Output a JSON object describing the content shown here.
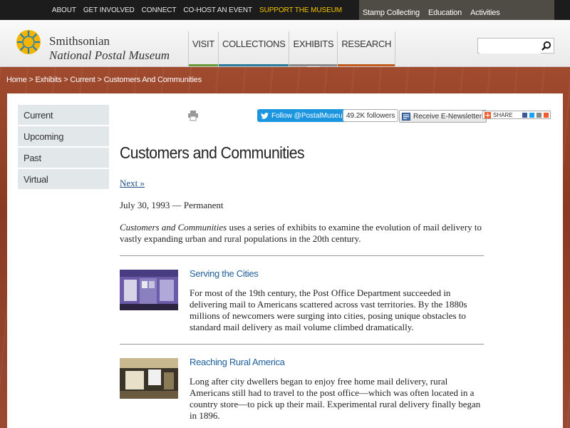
{
  "topbar": {
    "links": [
      "ABOUT",
      "GET INVOLVED",
      "CONNECT",
      "CO-HOST AN EVENT",
      "SUPPORT THE MUSEUM"
    ],
    "dropdown_links": [
      "Stamp Collecting",
      "Education",
      "Activities"
    ],
    "support_color": "#f5c400"
  },
  "header": {
    "logo_line1": "Smithsonian",
    "logo_line2": "National Postal Museum",
    "nav": [
      {
        "label": "VISIT",
        "color": "#6a9a3a"
      },
      {
        "label": "COLLECTIONS",
        "color": "#2d7a9a"
      },
      {
        "label": "EXHIBITS",
        "color": "#8a8a8a",
        "active": true
      },
      {
        "label": "RESEARCH",
        "color": "#c25a1e"
      }
    ],
    "search_placeholder": ""
  },
  "breadcrumb": [
    "Home",
    "Exhibits",
    "Current",
    "Customers And Communities"
  ],
  "sidenav": [
    "Current",
    "Upcoming",
    "Past",
    "Virtual"
  ],
  "social": {
    "twitter_label": "Follow @PostalMuseum",
    "followers": "49.2K followers",
    "newsletter": "Receive E-Newsletter",
    "share": "SHARE"
  },
  "content": {
    "title": "Customers and Communities",
    "next": "Next »",
    "date": "July 30, 1993 — Permanent",
    "intro_em": "Customers and Communities",
    "intro_rest": " uses a series of exhibits to examine the evolution of mail delivery to vastly expanding urban and rural populations in the 20th century.",
    "entries": [
      {
        "title": "Serving the Cities",
        "text": "For most of the 19th century, the Post Office Department succeeded in delivering mail to Americans scattered across vast territories. By the 1880s millions of newcomers were surging into cities, posing unique obstacles to standard mail delivery as mail volume climbed dramatically."
      },
      {
        "title": "Reaching Rural America",
        "text": "Long after city dwellers began to enjoy free home mail delivery, rural Americans still had to travel to the post office—which was often located in a country store—to pick up their mail. Experimental rural delivery finally began in 1896."
      }
    ]
  }
}
